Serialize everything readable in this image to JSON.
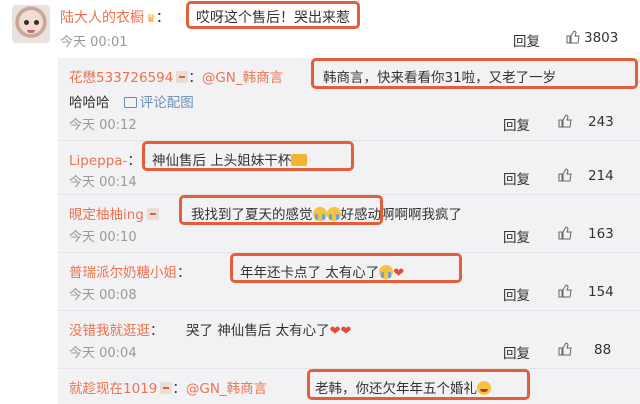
{
  "top_comment": {
    "author": "陆大人的衣橱",
    "text": "哎呀这个售后！哭出来惹",
    "time": "今天 00:01",
    "reply_label": "回复",
    "likes": "3803"
  },
  "replies": [
    {
      "author": "花懋533726594",
      "mention": "@GN_韩商言",
      "text": "韩商言，快来看看你31啦，又老了一岁",
      "text_line2": "哈哈哈",
      "image_link": "评论配图",
      "time": "今天 00:12",
      "reply_label": "回复",
      "likes": "243"
    },
    {
      "author": "Lipeppa-",
      "text": "神仙售后 上头姐妹干杯",
      "time": "今天 00:14",
      "reply_label": "回复",
      "likes": "214"
    },
    {
      "author": "晛定柚柚ing",
      "text": "我找到了夏天的感觉",
      "text_tail": "好感动啊啊啊我疯了",
      "time": "今天 00:10",
      "reply_label": "回复",
      "likes": "163"
    },
    {
      "author": "普瑞派尔奶糖小姐",
      "text": "年年还卡点了  太有心了",
      "time": "今天 00:08",
      "reply_label": "回复",
      "likes": "154"
    },
    {
      "author": "没错我就逛逛",
      "text": "哭了 神仙售后 太有心了",
      "time": "今天 00:04",
      "reply_label": "回复",
      "likes": "88"
    },
    {
      "author": "就趁现在1019",
      "mention": "@GN_韩商言",
      "text": "老韩，你还欠年年五个婚礼"
    }
  ],
  "colors": {
    "username": "#eb7350",
    "highlight_box": "#e35f3b",
    "reply_bg": "#f2f2f5",
    "time": "#999999"
  },
  "icons": [
    "crown-icon",
    "badge-icon",
    "thumbs-up-icon",
    "image-icon",
    "emoji-icon",
    "heart-icon"
  ]
}
